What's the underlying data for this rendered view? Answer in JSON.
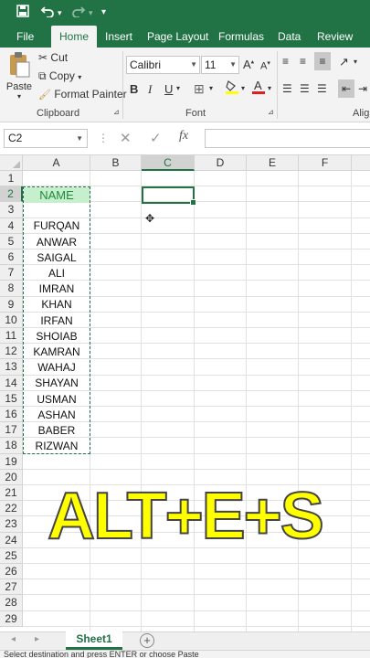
{
  "quick_access": {
    "save_icon": "save-icon",
    "undo_icon": "undo-icon",
    "redo_icon": "redo-icon",
    "customize_icon": "customize-icon"
  },
  "ribbon_tabs": [
    "File",
    "Home",
    "Insert",
    "Page Layout",
    "Formulas",
    "Data",
    "Review"
  ],
  "active_tab": "Home",
  "clipboard": {
    "paste_label": "Paste",
    "cut_label": "Cut",
    "copy_label": "Copy",
    "format_painter_label": "Format Painter",
    "group_label": "Clipboard"
  },
  "font": {
    "font_name": "Calibri",
    "font_size": "11",
    "bold": "B",
    "italic": "I",
    "underline": "U",
    "group_label": "Font"
  },
  "alignment": {
    "group_label": "Align"
  },
  "formula_bar": {
    "name_box": "C2",
    "fx_label": "fx",
    "content": ""
  },
  "columns": [
    "A",
    "B",
    "C",
    "D",
    "E",
    "F"
  ],
  "selected_column": "C",
  "rows": [
    "1",
    "2",
    "3",
    "4",
    "5",
    "6",
    "7",
    "8",
    "9",
    "10",
    "11",
    "12",
    "13",
    "14",
    "15",
    "16",
    "17",
    "18",
    "19",
    "20",
    "21",
    "22",
    "23",
    "24",
    "25",
    "26",
    "27",
    "28",
    "29"
  ],
  "selected_row": "2",
  "column_a": {
    "header": "NAME",
    "names": [
      "FURQAN",
      "ANWAR",
      "SAIGAL",
      "ALI",
      "IMRAN",
      "KHAN",
      "IRFAN",
      "SHOIAB",
      "KAMRAN",
      "WAHAJ",
      "SHAYAN",
      "USMAN",
      "ASHAN",
      "BABER",
      "RIZWAN"
    ]
  },
  "overlay_text": "ALT+E+S",
  "sheet_tab": "Sheet1",
  "add_sheet_icon": "add-sheet-icon",
  "status_text": "Select destination and press ENTER or choose Paste",
  "colors": {
    "excel_green": "#217346",
    "header_fill": "#c6efce",
    "header_text": "#1f8a3b",
    "overlay_fill": "#ffff00"
  }
}
